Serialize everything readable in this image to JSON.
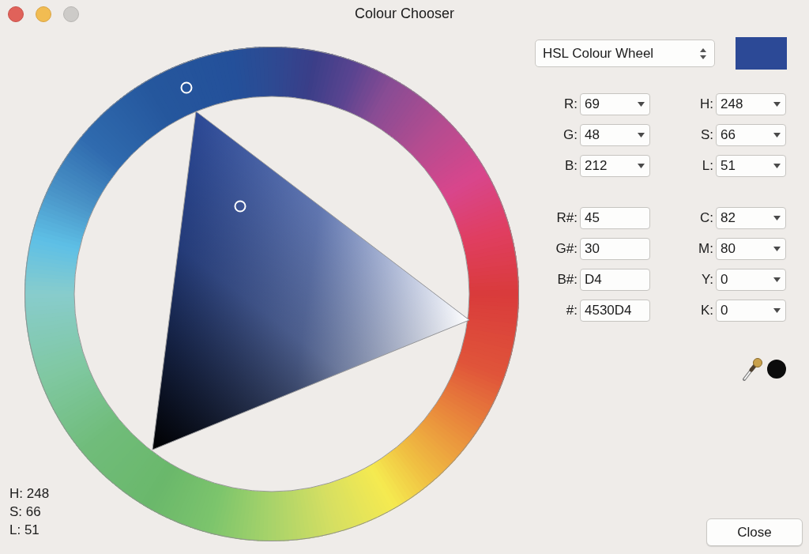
{
  "window": {
    "title": "Colour Chooser",
    "controls": [
      {
        "kind": "close",
        "disabled": false
      },
      {
        "kind": "minimize",
        "disabled": false
      },
      {
        "kind": "zoom",
        "disabled": true
      }
    ]
  },
  "mode_select": {
    "value": "HSL Colour Wheel"
  },
  "preview": {
    "color": "#2c4996"
  },
  "field_groups": [
    {
      "rows": [
        {
          "left": {
            "label": "R:",
            "value": "69",
            "kind": "dropdown"
          },
          "right": {
            "label": "H:",
            "value": "248",
            "kind": "dropdown"
          }
        },
        {
          "left": {
            "label": "G:",
            "value": "48",
            "kind": "dropdown"
          },
          "right": {
            "label": "S:",
            "value": "66",
            "kind": "dropdown"
          }
        },
        {
          "left": {
            "label": "B:",
            "value": "212",
            "kind": "dropdown"
          },
          "right": {
            "label": "L:",
            "value": "51",
            "kind": "dropdown"
          }
        }
      ]
    },
    {
      "rows": [
        {
          "left": {
            "label": "R#:",
            "value": "45",
            "kind": "text"
          },
          "right": {
            "label": "C:",
            "value": "82",
            "kind": "dropdown"
          }
        },
        {
          "left": {
            "label": "G#:",
            "value": "30",
            "kind": "text"
          },
          "right": {
            "label": "M:",
            "value": "80",
            "kind": "dropdown"
          }
        },
        {
          "left": {
            "label": "B#:",
            "value": "D4",
            "kind": "text"
          },
          "right": {
            "label": "Y:",
            "value": "0",
            "kind": "dropdown"
          }
        },
        {
          "left": {
            "label": "#:",
            "value": "4530D4",
            "kind": "text"
          },
          "right": {
            "label": "K:",
            "value": "0",
            "kind": "dropdown"
          }
        }
      ]
    }
  ],
  "wheel_readout": [
    "H: 248",
    "S: 66",
    "L: 51"
  ],
  "close_button": {
    "label": "Close"
  }
}
